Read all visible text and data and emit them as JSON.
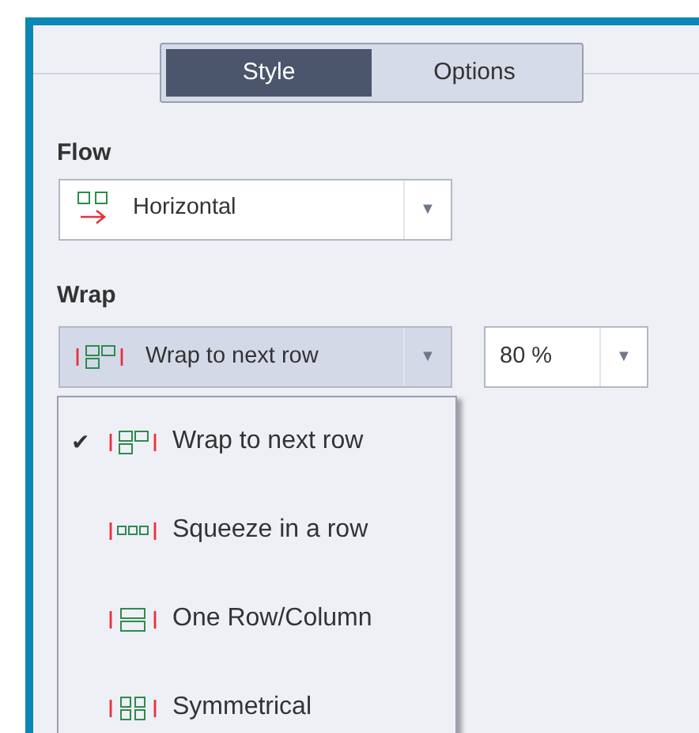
{
  "tabs": [
    {
      "label": "Style",
      "selected": true
    },
    {
      "label": "Options",
      "selected": false
    }
  ],
  "flow": {
    "label": "Flow",
    "value": "Horizontal",
    "kind": "horizontal",
    "arrow": "▼"
  },
  "wrap": {
    "label": "Wrap",
    "value": "Wrap to next row",
    "kind": "wrap",
    "arrow": "▼",
    "open": true
  },
  "percent": {
    "value": "80 %",
    "arrow": "▼"
  },
  "wrap_menu": {
    "check_mark": "✔",
    "items": [
      {
        "label": "Wrap to next row",
        "kind": "wrap",
        "checked": true
      },
      {
        "label": "Squeeze in a row",
        "kind": "squeeze",
        "checked": false
      },
      {
        "label": "One Row/Column",
        "kind": "onerow",
        "checked": false
      },
      {
        "label": "Symmetrical",
        "kind": "symmetrical",
        "checked": false
      }
    ]
  }
}
